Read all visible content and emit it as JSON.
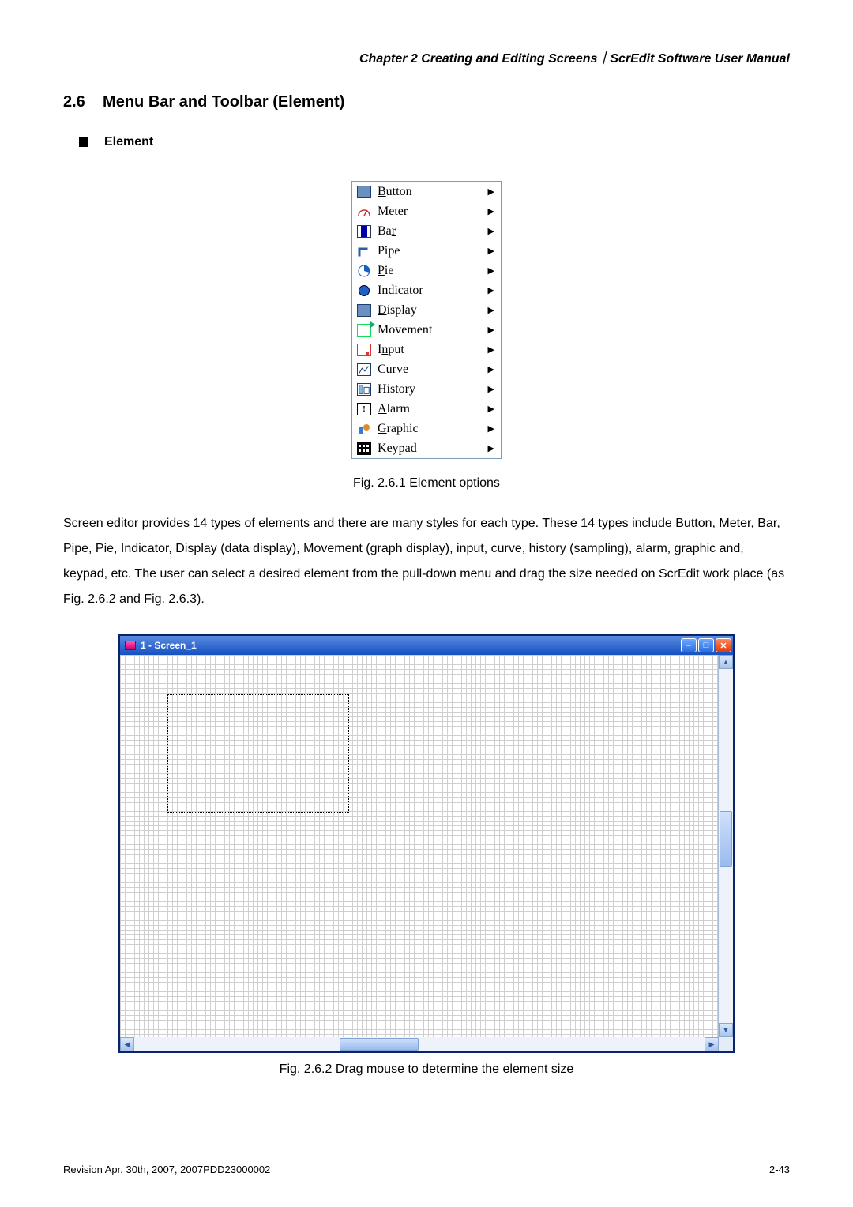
{
  "header": "Chapter 2  Creating and Editing Screens｜ScrEdit Software User Manual",
  "section": {
    "number": "2.6",
    "title": "Menu Bar and Toolbar (Element)"
  },
  "subhead": "Element",
  "menu": {
    "items": [
      {
        "label": "Button",
        "icon": "button-icon"
      },
      {
        "label": "Meter",
        "icon": "meter-icon"
      },
      {
        "label": "Bar",
        "icon": "bar-icon"
      },
      {
        "label": "Pipe",
        "icon": "pipe-icon"
      },
      {
        "label": "Pie",
        "icon": "pie-icon"
      },
      {
        "label": "Indicator",
        "icon": "indicator-icon"
      },
      {
        "label": "Display",
        "icon": "display-icon"
      },
      {
        "label": "Movement",
        "icon": "movement-icon"
      },
      {
        "label": "Input",
        "icon": "input-icon"
      },
      {
        "label": "Curve",
        "icon": "curve-icon"
      },
      {
        "label": "History",
        "icon": "history-icon"
      },
      {
        "label": "Alarm",
        "icon": "alarm-icon"
      },
      {
        "label": "Graphic",
        "icon": "graphic-icon"
      },
      {
        "label": "Keypad",
        "icon": "keypad-icon"
      }
    ]
  },
  "fig1_caption": "Fig. 2.6.1 Element options",
  "paragraph": "Screen editor provides 14 types of elements and there are many styles for each type. These 14 types include Button, Meter, Bar, Pipe, Pie, Indicator, Display (data display), Movement (graph display), input, curve, history (sampling), alarm, graphic and, keypad, etc. The user can select a desired element from the pull-down menu and drag the size needed on ScrEdit work place (as Fig. 2.6.2 and Fig. 2.6.3).",
  "window": {
    "title": "1 - Screen_1"
  },
  "fig2_caption": "Fig. 2.6.2 Drag mouse to determine the element size",
  "footer": {
    "left": "Revision Apr. 30th, 2007, 2007PDD23000002",
    "right": "2-43"
  }
}
